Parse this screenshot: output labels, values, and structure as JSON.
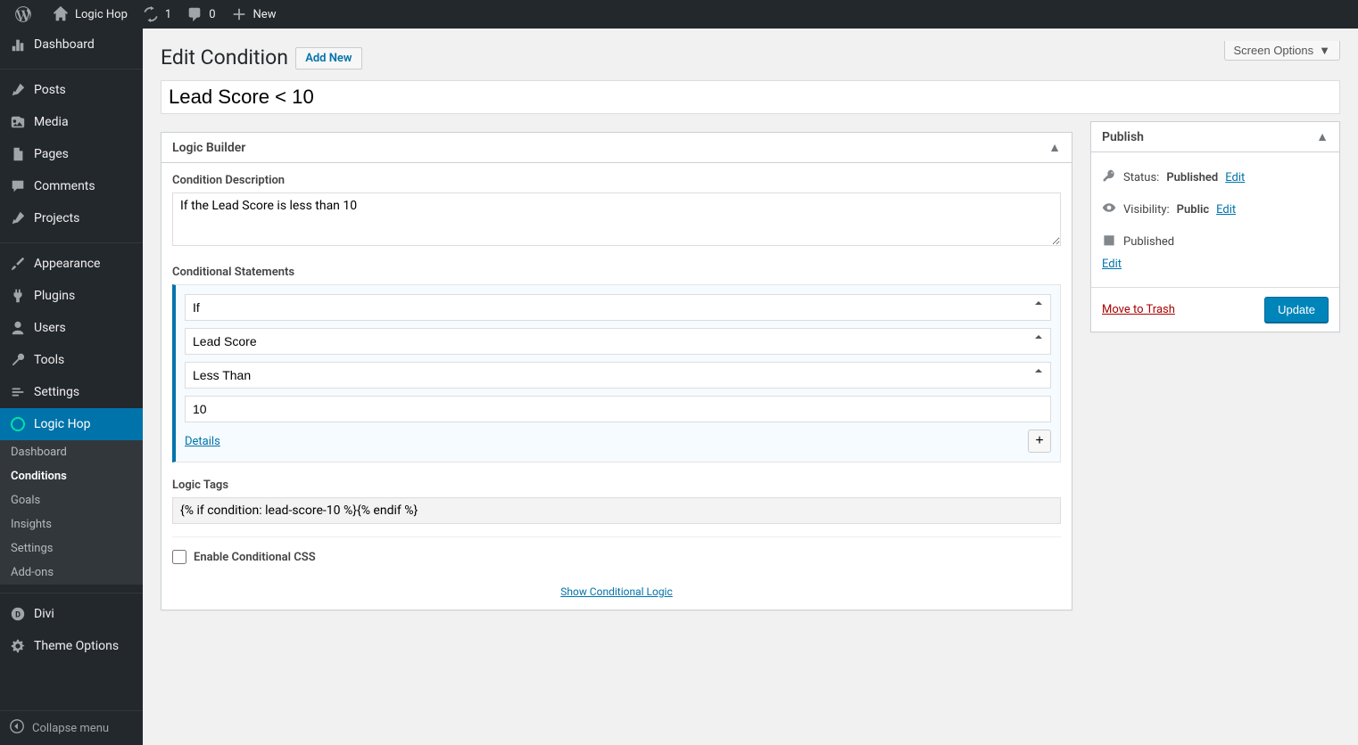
{
  "adminbar": {
    "site_name": "Logic Hop",
    "updates_count": "1",
    "comments_count": "0",
    "new_label": "New"
  },
  "sidebar": {
    "items": [
      {
        "label": "Dashboard"
      },
      {
        "label": "Posts"
      },
      {
        "label": "Media"
      },
      {
        "label": "Pages"
      },
      {
        "label": "Comments"
      },
      {
        "label": "Projects"
      },
      {
        "label": "Appearance"
      },
      {
        "label": "Plugins"
      },
      {
        "label": "Users"
      },
      {
        "label": "Tools"
      },
      {
        "label": "Settings"
      },
      {
        "label": "Logic Hop"
      },
      {
        "label": "Divi"
      },
      {
        "label": "Theme Options"
      }
    ],
    "logichop_submenu": [
      {
        "label": "Dashboard"
      },
      {
        "label": "Conditions"
      },
      {
        "label": "Goals"
      },
      {
        "label": "Insights"
      },
      {
        "label": "Settings"
      },
      {
        "label": "Add-ons"
      }
    ],
    "collapse_label": "Collapse menu"
  },
  "header": {
    "screen_options_label": "Screen Options",
    "page_title": "Edit Condition",
    "add_new_label": "Add New"
  },
  "post": {
    "title": "Lead Score < 10"
  },
  "logic_builder": {
    "box_title": "Logic Builder",
    "desc_label": "Condition Description",
    "desc_value": "If the Lead Score is less than 10",
    "cond_label": "Conditional Statements",
    "select_if": "If",
    "select_field": "Lead Score",
    "select_op": "Less Than",
    "input_value": "10",
    "details_label": "Details",
    "add_btn_label": "+",
    "tags_label": "Logic Tags",
    "tags_value": "{% if condition: lead-score-10 %}{% endif %}",
    "enable_css_label": "Enable Conditional CSS",
    "show_logic_label": "Show Conditional Logic"
  },
  "publish": {
    "box_title": "Publish",
    "status_label": "Status:",
    "status_value": "Published",
    "status_edit": "Edit",
    "visibility_label": "Visibility:",
    "visibility_value": "Public",
    "visibility_edit": "Edit",
    "published_label": "Published",
    "published_edit": "Edit",
    "trash_label": "Move to Trash",
    "update_label": "Update"
  }
}
